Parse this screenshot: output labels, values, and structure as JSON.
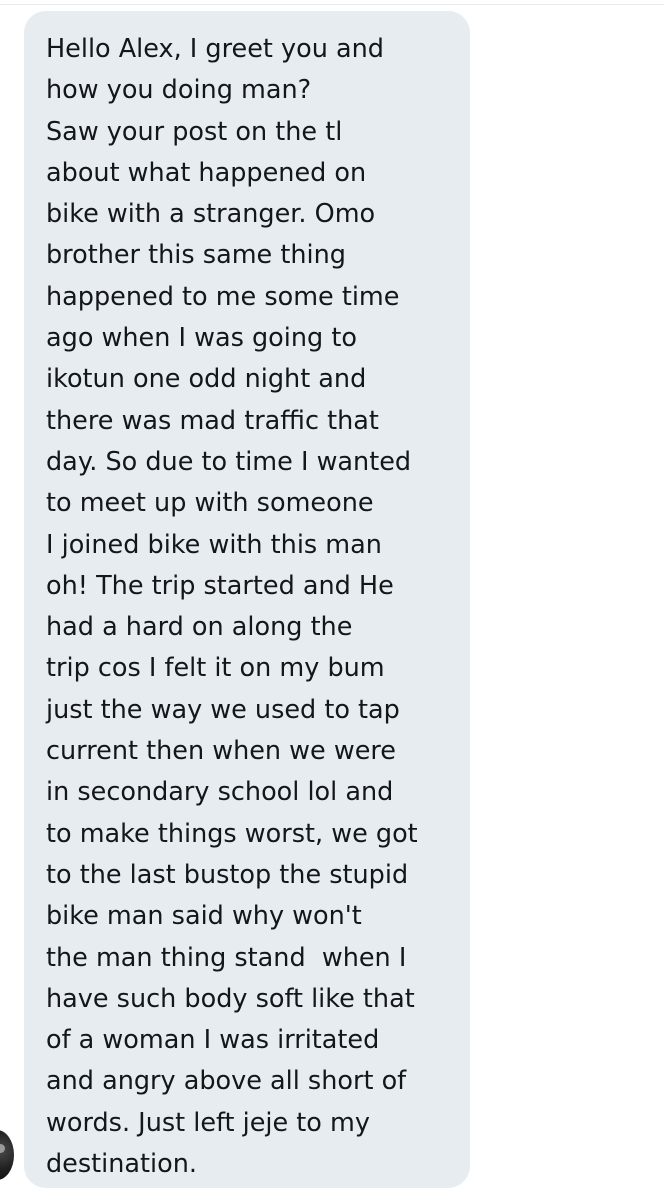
{
  "conversation": {
    "message": {
      "lines": [
        "Hello Alex, I greet you and",
        "how you doing man?",
        "Saw your post on the tl",
        "about what happened on",
        "bike with a stranger. Omo",
        "brother this same thing",
        "happened to me some time",
        "ago when I was going to",
        "ikotun one odd night and",
        "there was mad traffic that",
        "day. So due to time I wanted",
        "to meet up with someone",
        "I joined bike with this man",
        "oh! The trip started and He",
        "had a hard on along the",
        "trip cos I felt it on my bum",
        "just the way we used to tap",
        "current then when we were",
        "in secondary school lol and",
        "to make things worst, we got",
        "to the last bustop the stupid",
        "bike man said why won't",
        "the man thing stand  when I",
        "have such body soft like that",
        "of a woman I was irritated",
        "and angry above all short of",
        "words. Just left jeje to my",
        "destination."
      ]
    },
    "colors": {
      "bubble_background": "#e6ecf0",
      "text": "#14171a",
      "page_background": "#ffffff"
    }
  }
}
